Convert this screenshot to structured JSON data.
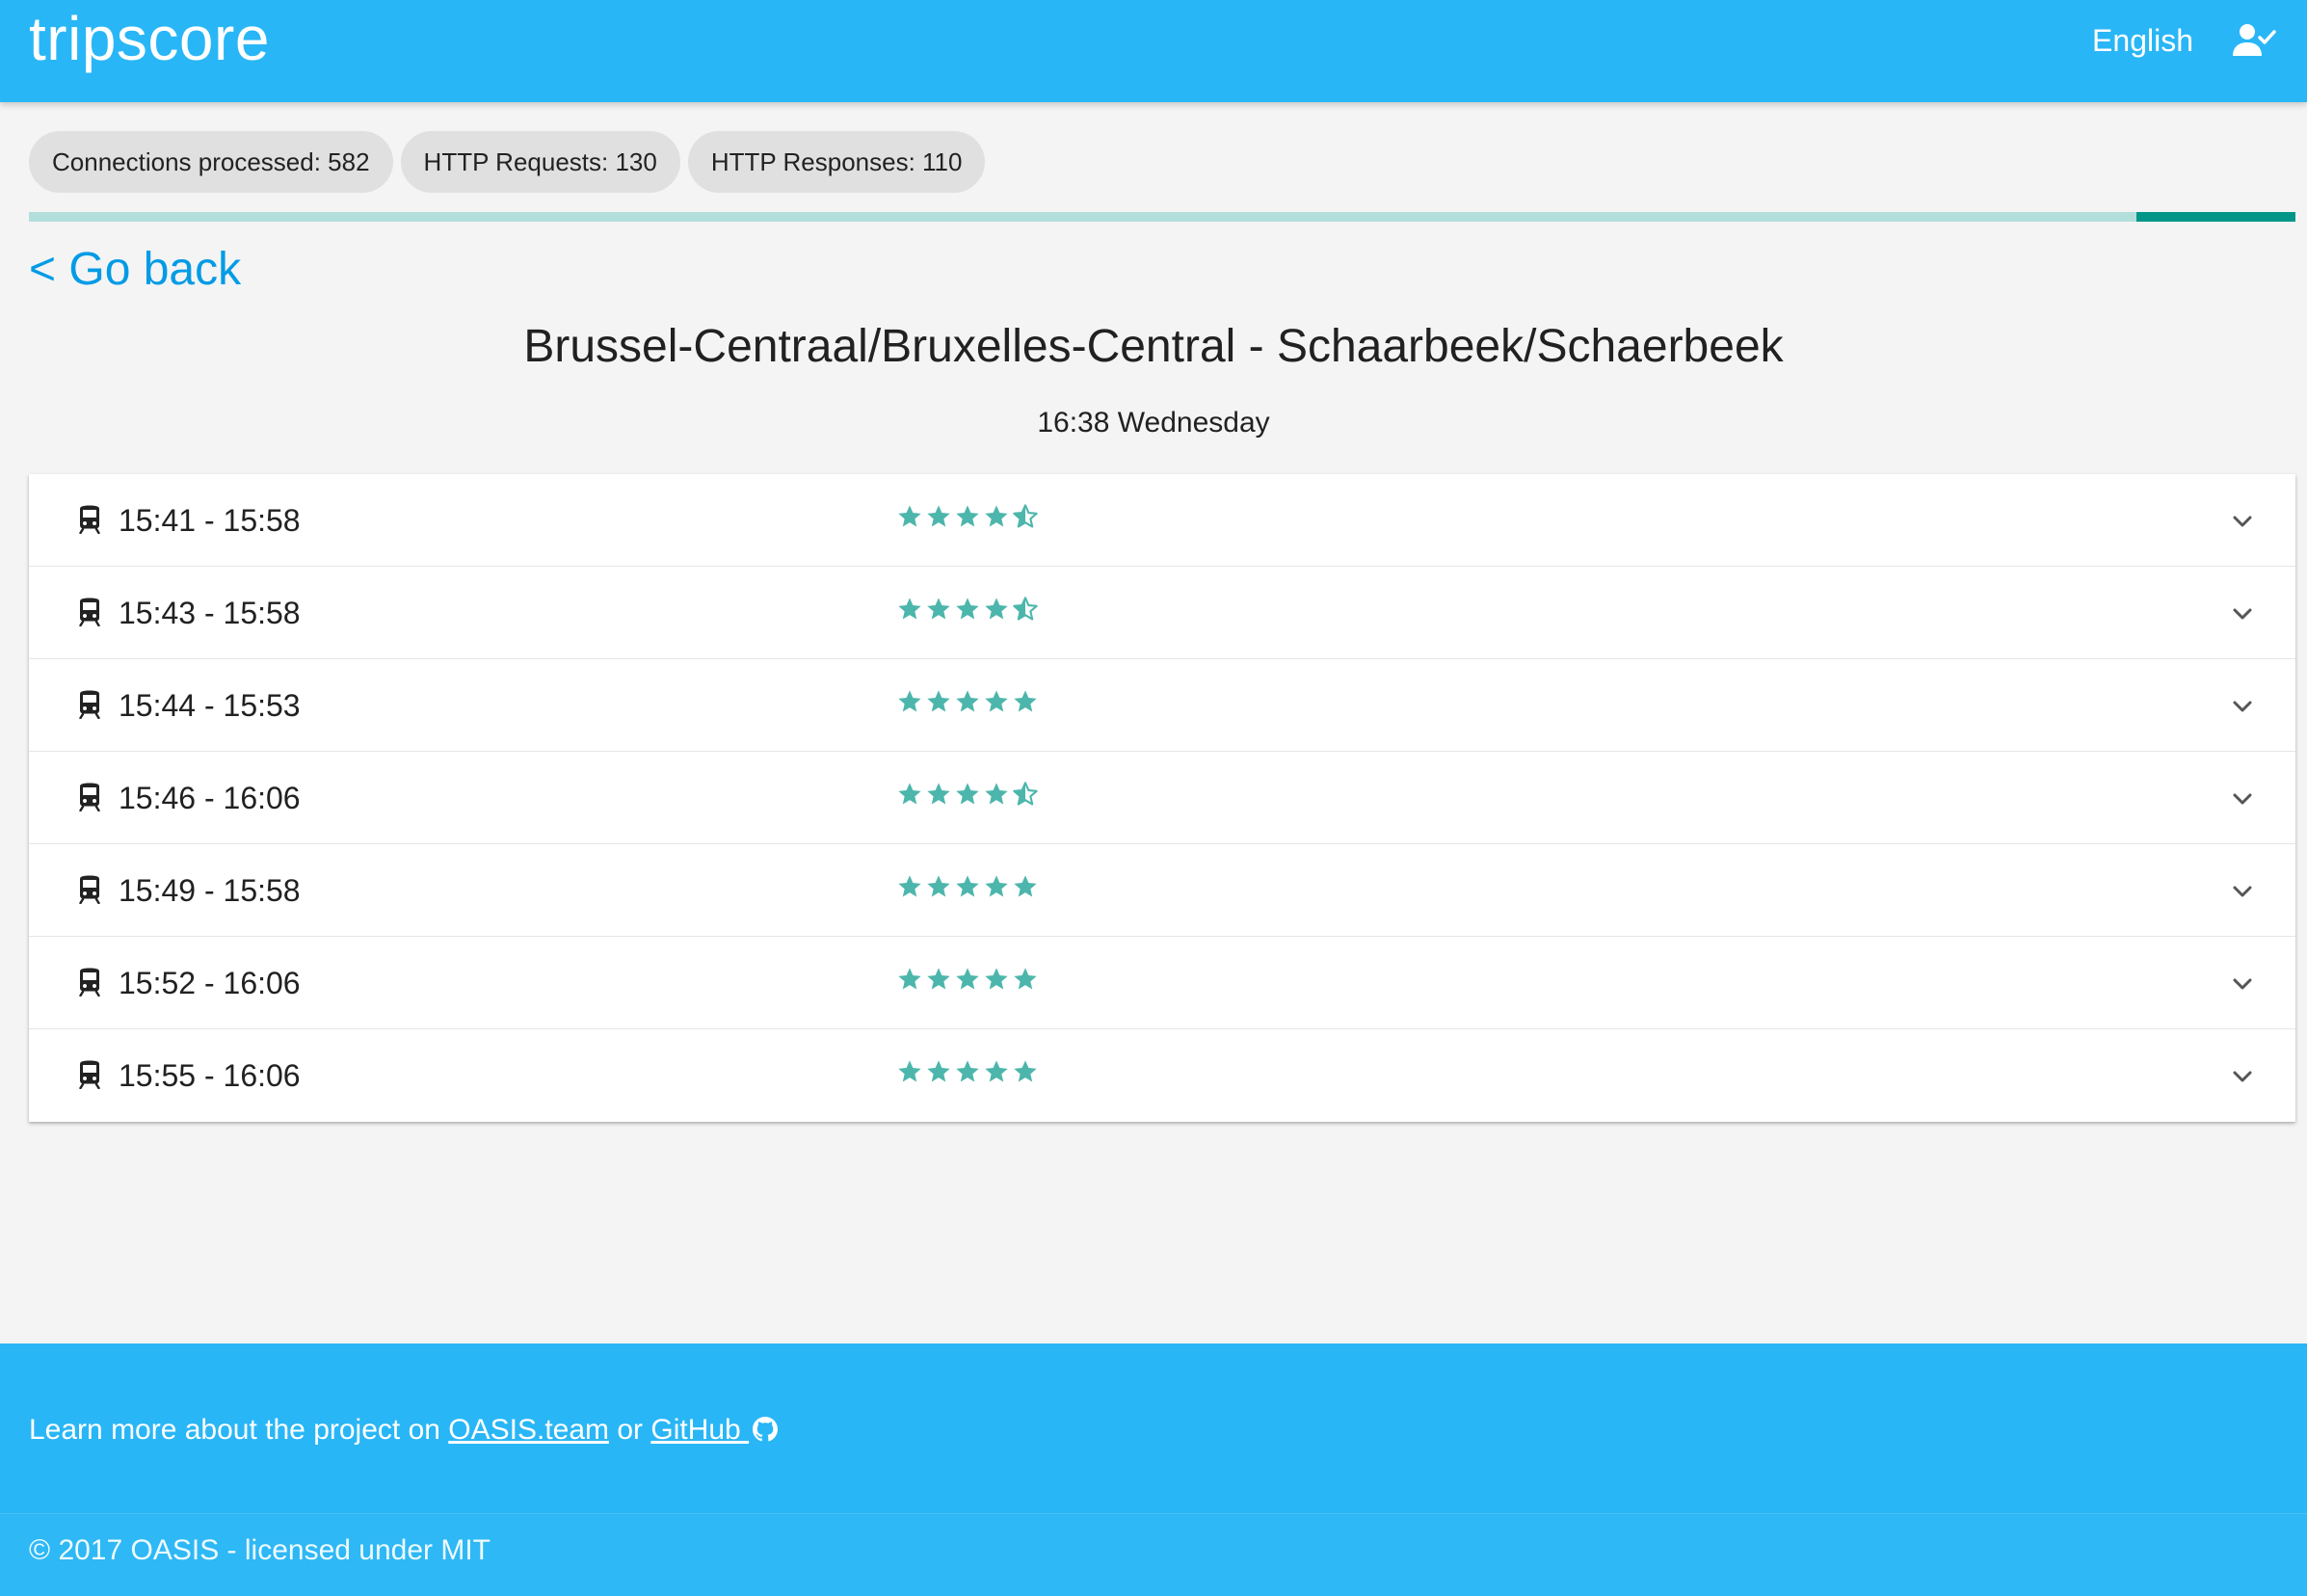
{
  "header": {
    "brand": "tripscore",
    "language": "English",
    "user_icon": "person-check-icon"
  },
  "stats": {
    "connections": "Connections processed: 582",
    "requests": "HTTP Requests: 130",
    "responses": "HTTP Responses: 110"
  },
  "progress": {
    "fraction": 0.93
  },
  "navigation": {
    "go_back": "< Go back"
  },
  "route": {
    "title": "Brussel-Centraal/Bruxelles-Central - Schaarbeek/Schaerbeek",
    "time": "16:38 Wednesday"
  },
  "trips": [
    {
      "time": "15:41 - 15:58",
      "rating": 4.5
    },
    {
      "time": "15:43 - 15:58",
      "rating": 4.5
    },
    {
      "time": "15:44 - 15:53",
      "rating": 5
    },
    {
      "time": "15:46 - 16:06",
      "rating": 4.5
    },
    {
      "time": "15:49 - 15:58",
      "rating": 5
    },
    {
      "time": "15:52 - 16:06",
      "rating": 5
    },
    {
      "time": "15:55 - 16:06",
      "rating": 5
    }
  ],
  "footer": {
    "learn_prefix": "Learn more about the project on ",
    "oasis_link": "OASIS.team",
    "or_text": " or ",
    "github_link": "GitHub ",
    "copyright": "© 2017 OASIS - licensed under MIT"
  },
  "colors": {
    "primary": "#29b6f6",
    "accent": "#009688",
    "star": "#4db6ac",
    "link": "#039be5"
  },
  "icons": {
    "train": "train-icon",
    "star": "star-icon",
    "half_star": "half-star-icon",
    "expand": "chevron-down-icon",
    "github": "github-icon"
  }
}
